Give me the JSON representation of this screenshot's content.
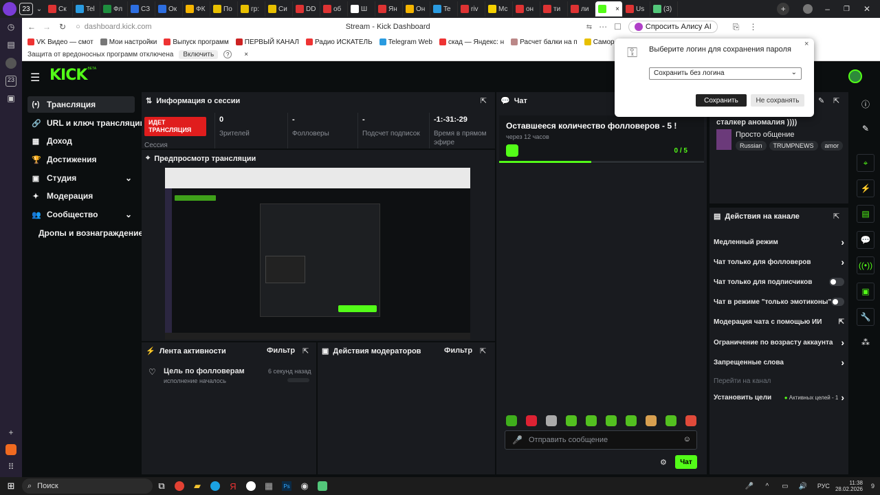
{
  "browser": {
    "tab_count_badge": "23",
    "tabs": [
      {
        "label": "Ск",
        "color": "#d33"
      },
      {
        "label": "Tel",
        "color": "#2a9be0"
      },
      {
        "label": "Фл",
        "color": "#1e8e3e"
      },
      {
        "label": "СЗ",
        "color": "#2d6ee0"
      },
      {
        "label": "Ок",
        "color": "#2d6ee0"
      },
      {
        "label": "ФК",
        "color": "#f4b400"
      },
      {
        "label": "По",
        "color": "#e8c000"
      },
      {
        "label": "гр:",
        "color": "#e8c000"
      },
      {
        "label": "Си",
        "color": "#e8c000"
      },
      {
        "label": "DD",
        "color": "#d33"
      },
      {
        "label": "об",
        "color": "#d33"
      },
      {
        "label": "Ш",
        "color": "#fff"
      },
      {
        "label": "Ян",
        "color": "#d33"
      },
      {
        "label": "Он",
        "color": "#f4b400"
      },
      {
        "label": "Te",
        "color": "#2a9be0"
      },
      {
        "label": "riv",
        "color": "#d33"
      },
      {
        "label": "Мс",
        "color": "#f4d000"
      },
      {
        "label": "он",
        "color": "#d33"
      },
      {
        "label": "ти",
        "color": "#d33"
      },
      {
        "label": "ли",
        "color": "#d33"
      },
      {
        "label": "",
        "color": "#53fc18"
      },
      {
        "label": "Us",
        "color": "#d33"
      },
      {
        "label": "(3)",
        "color": "#53c77a"
      }
    ],
    "address": "dashboard.kick.com",
    "page_title": "Stream - Kick Dashboard",
    "alice_button": "Спросить Алису AI",
    "bookmarks": [
      "VK Видео — смот",
      "Мои настройки",
      "Выпуск программ",
      "ПЕРВЫЙ КАНАЛ",
      "Радио ИСКАТЕЛЬ",
      "Telegram Web",
      "скад — Яндекс: н",
      "Расчет балки на п",
      "Саморезы HARPC",
      "Катал"
    ],
    "warning_text": "Защита от вредоносных программ отключена",
    "warning_button": "Включить",
    "warning_help": "?",
    "close_glyph": "×"
  },
  "password_popup": {
    "title": "Выберите логин для сохранения пароля",
    "select_value": "Сохранить без логина",
    "save_button": "Сохранить",
    "dont_save_button": "Не сохранять"
  },
  "kick": {
    "logo": "KICK",
    "logo_beta": "BETA",
    "nav": [
      {
        "label": "Трансляция",
        "icon": "(•)",
        "active": true
      },
      {
        "label": "URL и ключ трансляции",
        "icon": "🔗"
      },
      {
        "label": "Доход",
        "icon": "▦"
      },
      {
        "label": "Достижения",
        "icon": "🏆"
      },
      {
        "label": "Студия",
        "icon": "▣",
        "expand": true
      },
      {
        "label": "Модерация",
        "icon": "✦"
      },
      {
        "label": "Сообщество",
        "icon": "👥",
        "expand": true
      },
      {
        "label": "Дропы и вознаграждение",
        "icon": ""
      }
    ],
    "session": {
      "title": "Информация о сессии",
      "live_badge": "ИДЕТ ТРАНСЛЯЦИЯ",
      "session_label": "Сессия",
      "stats": [
        {
          "value": "0",
          "label": "Зрителей"
        },
        {
          "value": "-",
          "label": "Фолловеры"
        },
        {
          "value": "-",
          "label": "Подсчет подписок"
        },
        {
          "value": "-1:-31:-29",
          "label": "Время в прямом эфире"
        }
      ]
    },
    "preview": {
      "title": "Предпросмотр трансляции"
    },
    "activity": {
      "title": "Лента активности",
      "filter": "Фильтр",
      "items": [
        {
          "title": "Цель по фолловерам",
          "subtitle": "исполнение началось",
          "time": "6 секунд назад"
        }
      ]
    },
    "mod_actions": {
      "title": "Действия модераторов",
      "filter": "Фильтр"
    },
    "chat": {
      "title": "Чат",
      "goal_title": "Оставшееся количество фолловеров - 5 !",
      "goal_time": "через 12 часов",
      "goal_progress": "0 / 5",
      "progress_fraction": 0.45,
      "input_placeholder": "Отправить сообщение",
      "send_button": "Чат"
    },
    "stream_info": {
      "title_line": "сталкер аномалия ))))",
      "category": "Просто общение",
      "tags": [
        "Russian",
        "TRUMPNEWS",
        "amor"
      ]
    },
    "channel_actions": {
      "title": "Действия на канале",
      "items": [
        {
          "label": "Медленный режим",
          "control": "chevron"
        },
        {
          "label": "Чат только для фолловеров",
          "control": "chevron"
        },
        {
          "label": "Чат только для подписчиков",
          "control": "toggle"
        },
        {
          "label": "Чат в режиме \"только эмотиконы\"",
          "control": "toggle"
        },
        {
          "label": "Модерация чата с помощью ИИ",
          "control": "external"
        },
        {
          "label": "Ограничение по возрасту аккаунта",
          "control": "chevron"
        },
        {
          "label": "Запрещенные слова",
          "control": "chevron"
        },
        {
          "label": "Перейти на канал",
          "control": "none",
          "muted": true
        },
        {
          "label": "Установить цели",
          "control": "chevron",
          "extra": "Активных целей - 1"
        }
      ]
    }
  },
  "taskbar": {
    "search": "Поиск",
    "lang": "РУС",
    "time": "11:38",
    "date": "28.02.2026",
    "notif": "9"
  }
}
